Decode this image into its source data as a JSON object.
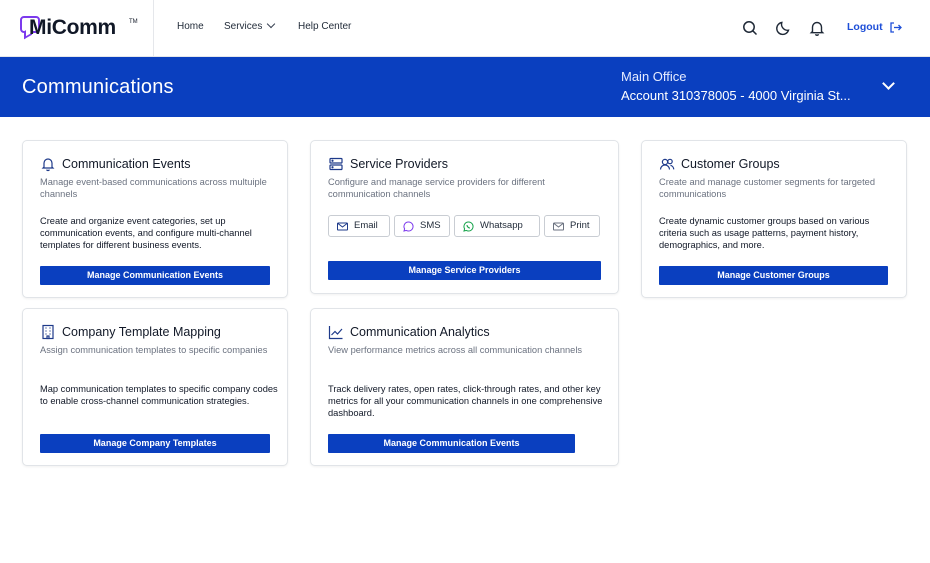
{
  "brand": {
    "name": "MiComm",
    "tm": "TM"
  },
  "nav": {
    "home": "Home",
    "services": "Services",
    "help": "Help Center"
  },
  "header": {
    "logout": "Logout"
  },
  "banner": {
    "title": "Communications",
    "office_label": "Main Office",
    "office_account": "Account 310378005 - 4000 Virginia St..."
  },
  "cards": [
    {
      "title": "Communication Events",
      "subtitle": "Manage event-based communications across multuiple channels",
      "description": "Create and organize event categories, set up communication events, and configure multi-channel templates for different business events.",
      "button": "Manage Communication Events",
      "icon": "bell-icon"
    },
    {
      "title": "Service Providers",
      "subtitle": "Configure and manage service providers for different communication channels",
      "chips": [
        "Email",
        "SMS",
        "Whatsapp",
        "Print"
      ],
      "button": "Manage Service Providers",
      "icon": "server-icon"
    },
    {
      "title": "Customer Groups",
      "subtitle": "Create and manage customer segments for targeted communications",
      "description": "Create dynamic customer groups based on various criteria such as usage patterns, payment history, demographics, and more.",
      "button": "Manage Customer Groups",
      "icon": "users-icon"
    },
    {
      "title": "Company Template Mapping",
      "subtitle": "Assign communication templates to specific companies",
      "description": "Map communication templates to specific company codes to enable cross-channel communication strategies.",
      "button": "Manage Company Templates",
      "icon": "building-icon"
    },
    {
      "title": "Communication Analytics",
      "subtitle": "View performance metrics across all communication channels",
      "description": "Track delivery rates, open rates, click-through rates, and other key metrics for all your communication channels in one comprehensive dashboard.",
      "button": "Manage Communication Events",
      "icon": "chart-line-icon"
    }
  ],
  "colors": {
    "primary": "#0a3fbf",
    "accent_logo": "#7c3aed",
    "link": "#1d4ed8"
  }
}
